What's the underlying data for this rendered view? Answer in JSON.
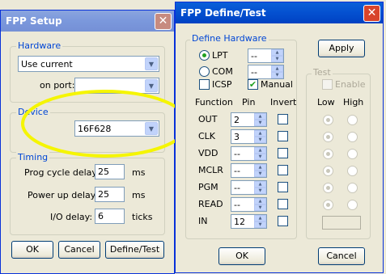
{
  "setup": {
    "title": "FPP Setup",
    "hardware": {
      "group_label": "Hardware",
      "selection": "Use current",
      "port_label": "on port:",
      "port_value": ""
    },
    "device": {
      "group_label": "Device",
      "selection": "16F628"
    },
    "timing": {
      "group_label": "Timing",
      "prog_cycle_label": "Prog cycle delay:",
      "prog_cycle_value": "25",
      "prog_cycle_unit": "ms",
      "power_up_label": "Power up delay:",
      "power_up_value": "25",
      "power_up_unit": "ms",
      "io_label": "I/O delay:",
      "io_value": "6",
      "io_unit": "ticks"
    },
    "buttons": {
      "ok": "OK",
      "cancel": "Cancel",
      "define_test": "Define/Test"
    }
  },
  "define": {
    "title": "FPP Define/Test",
    "hardware_group_label": "Define Hardware",
    "lpt_label": "LPT",
    "lpt_value": "--",
    "com_label": "COM",
    "com_value": "--",
    "icsp_label": "ICSP",
    "manual_label": "Manual",
    "col_function": "Function",
    "col_pin": "Pin",
    "col_invert": "Invert",
    "rows": [
      {
        "function": "OUT",
        "pin": "2"
      },
      {
        "function": "CLK",
        "pin": "3"
      },
      {
        "function": "VDD",
        "pin": "--"
      },
      {
        "function": "MCLR",
        "pin": "--"
      },
      {
        "function": "PGM",
        "pin": "--"
      },
      {
        "function": "READ",
        "pin": "--"
      },
      {
        "function": "IN",
        "pin": "12"
      }
    ],
    "apply_label": "Apply",
    "test_group_label": "Test",
    "enable_label": "Enable",
    "col_low": "Low",
    "col_high": "High",
    "ok_label": "OK",
    "cancel_label": "Cancel",
    "highlight_color": "#f5f500"
  }
}
